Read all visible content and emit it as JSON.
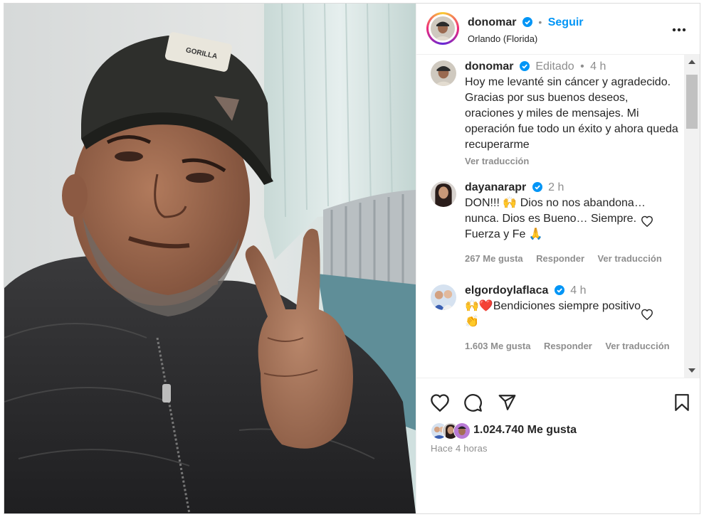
{
  "post": {
    "author": "donomar",
    "location": "Orlando (Florida)",
    "follow_label": "Seguir",
    "separator": "•",
    "caption": {
      "username": "donomar",
      "edited": "Editado",
      "dot": "•",
      "age": "4 h",
      "text": "Hoy me levanté sin cáncer y agradecido. Gracias por sus buenos deseos, oraciones y miles de mensajes. Mi operación fue todo un éxito y ahora queda recuperarme",
      "translate": "Ver traducción"
    },
    "comments": [
      {
        "username": "dayanarapr",
        "age": "2 h",
        "text": "DON!!! 🙌 Dios no nos abandona… nunca. Dios es Bueno… Siempre. Fuerza y Fe 🙏",
        "likes": "267 Me gusta",
        "reply": "Responder",
        "translate": "Ver traducción"
      },
      {
        "username": "elgordoylaflaca",
        "age": "4 h",
        "text": "🙌❤️Bendiciones siempre positivo 👏",
        "likes": "1.603 Me gusta",
        "reply": "Responder",
        "translate": "Ver traducción"
      }
    ],
    "likes_count": "1.024.740 Me gusta",
    "posted": "Hace 4 horas"
  },
  "icons": {
    "more": "more-options-icon",
    "like": "heart-icon",
    "comment": "comment-icon",
    "share": "share-icon",
    "save": "bookmark-icon",
    "verified": "verified-badge-icon"
  },
  "colors": {
    "accent": "#0095f6",
    "text": "#262626",
    "muted": "#8e8e8e",
    "verified": "#0095f6",
    "heart_red": "#ed4956"
  }
}
